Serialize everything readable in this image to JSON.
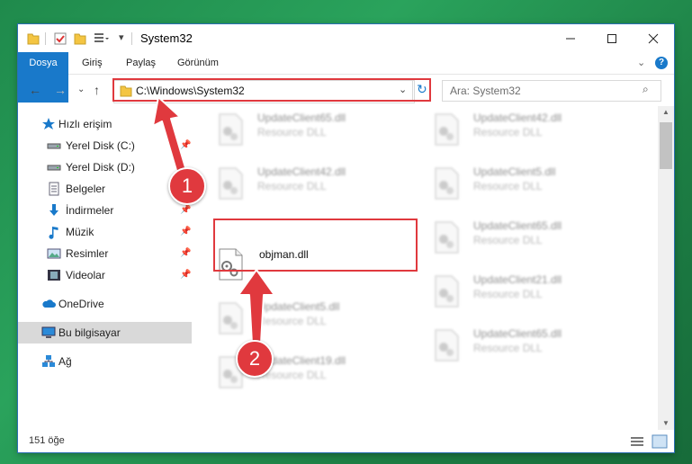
{
  "window": {
    "title": "System32",
    "accent": "#1979ca",
    "highlight_color": "#e0393e"
  },
  "ribbon": {
    "tabs": [
      {
        "label": "Dosya"
      },
      {
        "label": "Giriş"
      },
      {
        "label": "Paylaş"
      },
      {
        "label": "Görünüm"
      }
    ]
  },
  "address": {
    "path": "C:\\Windows\\System32",
    "search_placeholder": "Ara: System32"
  },
  "sidebar": {
    "items": [
      {
        "label": "Hızlı erişim",
        "icon": "star-icon"
      },
      {
        "label": "Yerel Disk (C:)",
        "icon": "drive-icon"
      },
      {
        "label": "Yerel Disk (D:)",
        "icon": "drive-icon"
      },
      {
        "label": "Belgeler",
        "icon": "documents-icon"
      },
      {
        "label": "İndirmeler",
        "icon": "download-icon"
      },
      {
        "label": "Müzik",
        "icon": "music-icon"
      },
      {
        "label": "Resimler",
        "icon": "pictures-icon"
      },
      {
        "label": "Videolar",
        "icon": "video-icon"
      },
      {
        "label": "OneDrive",
        "icon": "cloud-icon"
      },
      {
        "label": "Bu bilgisayar",
        "icon": "computer-icon"
      },
      {
        "label": "Ağ",
        "icon": "network-icon"
      }
    ]
  },
  "files": {
    "left": [
      {
        "name": "UpdateClient65.dll",
        "type": "Resource DLL"
      },
      {
        "name": "UpdateClient42.dll",
        "type": "Resource DLL"
      },
      {
        "name": "objman.dll",
        "type": ""
      },
      {
        "name": "UpdateClient5.dll",
        "type": "Resource DLL"
      },
      {
        "name": "UpdateClient19.dll",
        "type": "Resource DLL"
      }
    ],
    "right": [
      {
        "name": "UpdateClient42.dll",
        "type": "Resource DLL"
      },
      {
        "name": "UpdateClient5.dll",
        "type": "Resource DLL"
      },
      {
        "name": "UpdateClient65.dll",
        "type": "Resource DLL"
      },
      {
        "name": "UpdateClient21.dll",
        "type": "Resource DLL"
      },
      {
        "name": "UpdateClient65.dll",
        "type": "Resource DLL"
      }
    ]
  },
  "status": {
    "count": "151 öğe"
  },
  "annotations": {
    "step1": "1",
    "step2": "2"
  }
}
